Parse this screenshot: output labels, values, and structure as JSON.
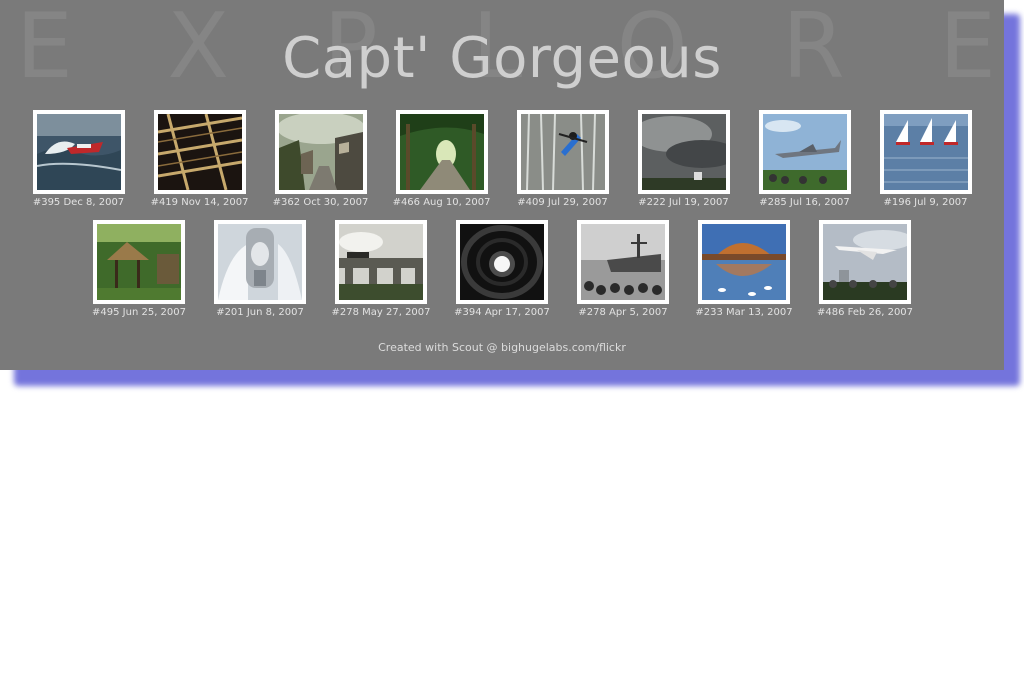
{
  "page": {
    "background_letters": [
      "E",
      "X",
      "P",
      "L",
      "O",
      "R",
      "E"
    ],
    "title": "Capt' Gorgeous",
    "footer": "Created with Scout @ bighugelabs.com/flickr",
    "colors": {
      "panel": "#7a7a7a",
      "shadow": "#7474dc",
      "title": "#cfcfcf"
    }
  },
  "photos_row1": [
    {
      "caption": "#395 Dec 8, 2007",
      "subject": "speedboat-on-waves"
    },
    {
      "caption": "#419 Nov 14, 2007",
      "subject": "steel-beams"
    },
    {
      "caption": "#362 Oct 30, 2007",
      "subject": "village-street"
    },
    {
      "caption": "#466 Aug 10, 2007",
      "subject": "tree-tunnel-path"
    },
    {
      "caption": "#409 Jul 29, 2007",
      "subject": "kayaker-waterfall"
    },
    {
      "caption": "#222 Jul 19, 2007",
      "subject": "storm-clouds"
    },
    {
      "caption": "#285 Jul 16, 2007",
      "subject": "jet-airshow"
    },
    {
      "caption": "#196 Jul 9, 2007",
      "subject": "sailboats"
    }
  ],
  "photos_row2": [
    {
      "caption": "#495 Jun 25, 2007",
      "subject": "thatched-hut"
    },
    {
      "caption": "#201 Jun 8, 2007",
      "subject": "silver-figure"
    },
    {
      "caption": "#278 May 27, 2007",
      "subject": "steam-train-viaduct"
    },
    {
      "caption": "#394 Apr 17, 2007",
      "subject": "dark-tunnel"
    },
    {
      "caption": "#278 Apr 5, 2007",
      "subject": "ship-crowd"
    },
    {
      "caption": "#233 Mar 13, 2007",
      "subject": "building-reflection"
    },
    {
      "caption": "#486 Feb 26, 2007",
      "subject": "concorde-flyover"
    }
  ]
}
